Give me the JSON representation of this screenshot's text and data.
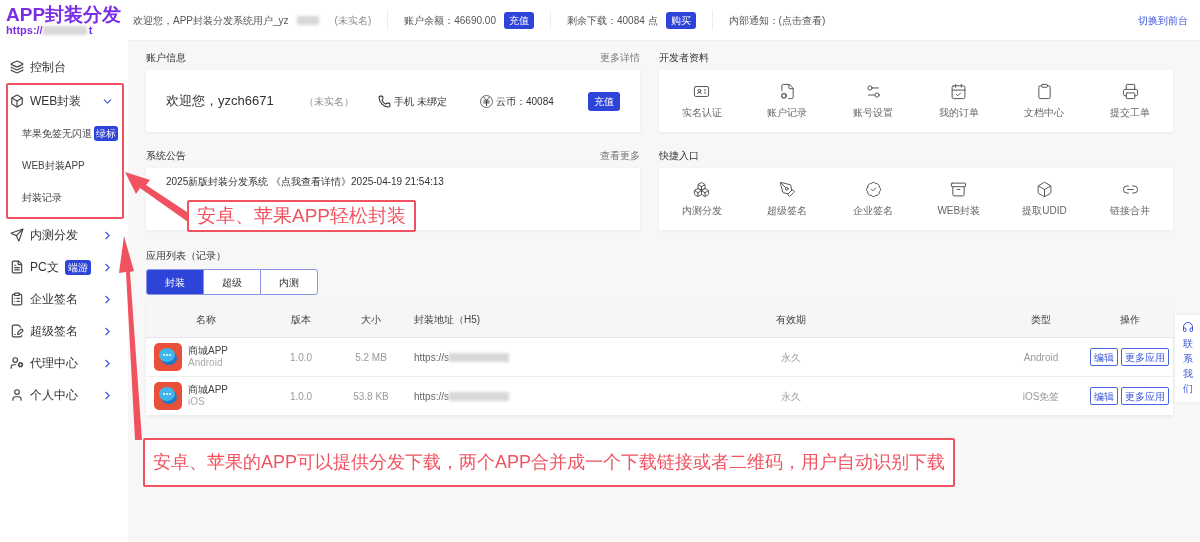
{
  "header": {
    "logo_title": "APP封装分发",
    "logo_url_start": "https://",
    "logo_url_end": "t",
    "welcome": "欢迎您，APP封装分发系统用户_yz",
    "welcome_status": "(未实名)",
    "balance": "账户余额：46690.00",
    "recharge": "充值",
    "downloads": "剩余下载：40084 点",
    "buy": "购买",
    "notice": "内部通知：(点击查看)",
    "switch": "切换到前台"
  },
  "sidebar": {
    "items": [
      {
        "label": "控制台"
      },
      {
        "label": "WEB封装",
        "expanded": true,
        "highlighted": true,
        "children": [
          {
            "label": "苹果免签无闪退",
            "badge": "绿标"
          },
          {
            "label": "WEB封装APP"
          },
          {
            "label": "封装记录"
          }
        ]
      },
      {
        "label": "内测分发",
        "expanded": false
      },
      {
        "label": "PC文",
        "badge": "端游",
        "expanded": false
      },
      {
        "label": "企业签名",
        "expanded": false
      },
      {
        "label": "超级签名",
        "expanded": false
      },
      {
        "label": "代理中心",
        "expanded": false
      },
      {
        "label": "个人中心",
        "expanded": false
      }
    ]
  },
  "account": {
    "title": "账户信息",
    "more": "更多详情",
    "greeting": "欢迎您，yzch6671",
    "status": "（未实名）",
    "phone": "手机 未绑定",
    "coins": "云币：40084",
    "recharge": "充值"
  },
  "developer": {
    "title": "开发者资料",
    "items": [
      "实名认证",
      "账户记录",
      "账号设置",
      "我的订单",
      "文档中心",
      "提交工单"
    ]
  },
  "announcement": {
    "title": "系统公告",
    "more": "查看更多",
    "text": "2025新版封装分发系统 《点我查看详情》2025-04-19 21:54:13"
  },
  "quick_entry": {
    "title": "快捷入口",
    "items": [
      "内测分发",
      "超级签名",
      "企业签名",
      "WEB封装",
      "提取UDID",
      "链接合并"
    ]
  },
  "app_list": {
    "title": "应用列表（记录）",
    "tabs": [
      {
        "label": "封装",
        "selected": true
      },
      {
        "label": "超级",
        "selected": false
      },
      {
        "label": "内测",
        "selected": false
      }
    ],
    "columns": [
      "名称",
      "版本",
      "大小",
      "封装地址（H5)",
      "有效期",
      "类型",
      "操作"
    ],
    "rows": [
      {
        "name": "商城APP",
        "platform": "Android",
        "version": "1.0.0",
        "size": "5.2 MB",
        "url": "https://s",
        "validity": "永久",
        "type": "Android",
        "actions": [
          "编辑",
          "更多应用"
        ]
      },
      {
        "name": "商城APP",
        "platform": "iOS",
        "version": "1.0.0",
        "size": "53.8 KB",
        "url": "https://s",
        "validity": "永久",
        "type": "iOS免签",
        "actions": [
          "编辑",
          "更多应用"
        ]
      }
    ]
  },
  "contact": "联系我们",
  "callouts": [
    "安卓、苹果APP轻松封装",
    "安卓、苹果的APP可以提供分发下载，两个APP合并成一个下载链接或者二维码，用户自动识别下载"
  ]
}
